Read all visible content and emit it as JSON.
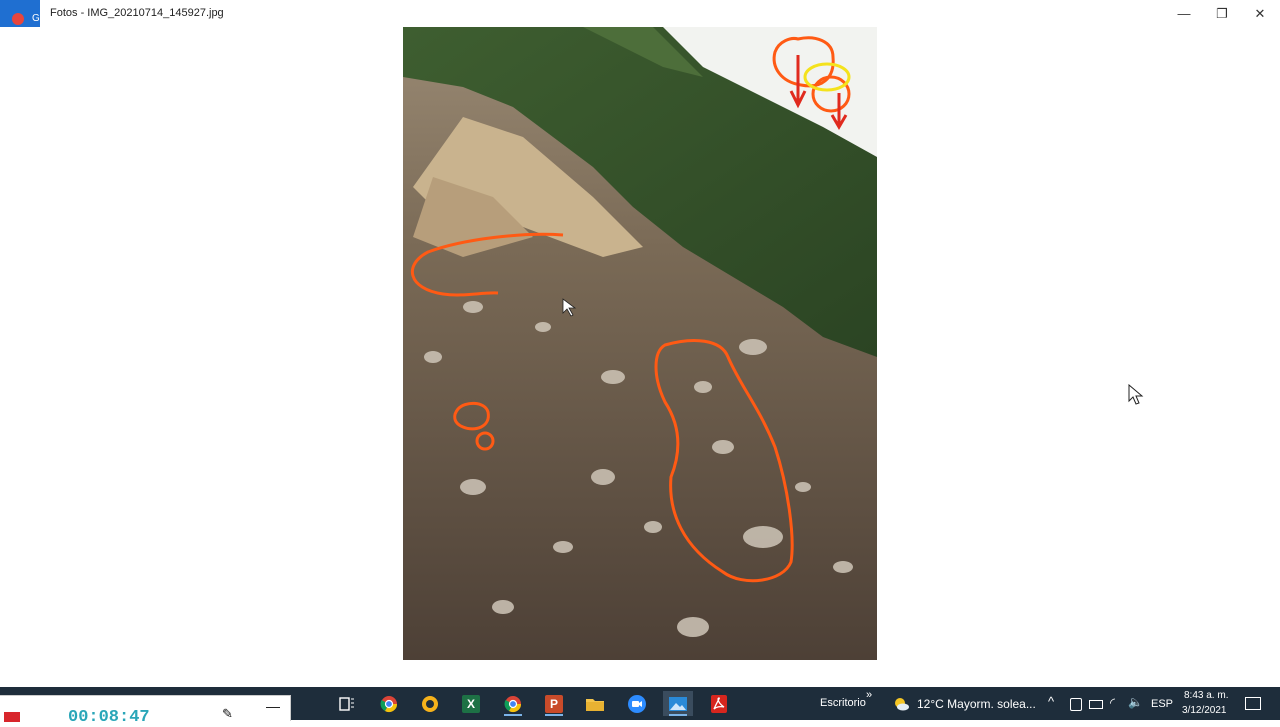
{
  "window": {
    "title": "Fotos - IMG_20210714_145927.jpg",
    "badge_char": "G"
  },
  "window_controls": {
    "minimize": "—",
    "maximize": "❐",
    "close": "✕"
  },
  "recorder": {
    "time": "00:08:47",
    "pen_icon": "pen-icon",
    "minimize": "—"
  },
  "taskbar": {
    "apps": [
      {
        "name": "task-view",
        "glyph": "▭"
      },
      {
        "name": "chrome",
        "glyph": ""
      },
      {
        "name": "norton",
        "glyph": ""
      },
      {
        "name": "excel",
        "glyph": "X"
      },
      {
        "name": "chrome-2",
        "glyph": ""
      },
      {
        "name": "powerpoint",
        "glyph": "P"
      },
      {
        "name": "file-explorer",
        "glyph": ""
      },
      {
        "name": "zoom",
        "glyph": ""
      },
      {
        "name": "photos",
        "glyph": ""
      },
      {
        "name": "acrobat",
        "glyph": ""
      }
    ],
    "desktop_label": "Escritorio",
    "chevron": "»",
    "weather": "12°C  Mayorm. solea...",
    "lang": "ESP",
    "time": "8:43 a. m.",
    "date": "3/12/2021"
  },
  "colors": {
    "taskbar": "#1e2d3b",
    "annotation": "#ff5a14",
    "highlight": "#f4e21c",
    "arrow": "#e02a1e"
  }
}
